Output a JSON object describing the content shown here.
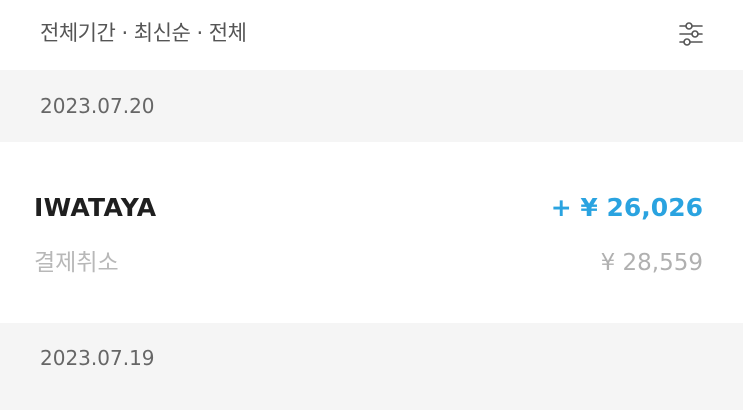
{
  "filter": {
    "label": "전체기간 · 최신순 · 전체",
    "icon": "sliders-icon"
  },
  "groups": [
    {
      "date": "2023.07.20",
      "transactions": [
        {
          "merchant": "IWATAYA",
          "status": "결제취소",
          "amount": "+ ¥ 26,026",
          "original_amount": "¥ 28,559"
        }
      ]
    },
    {
      "date": "2023.07.19"
    }
  ],
  "colors": {
    "accent_blue": "#2aa3e0",
    "section_bg": "#f5f5f5",
    "muted_text": "#b8b8b8"
  }
}
